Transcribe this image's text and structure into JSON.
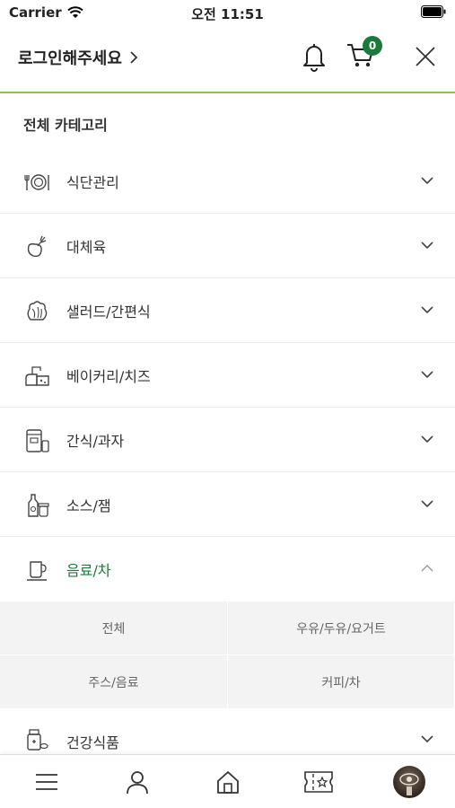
{
  "status_bar": {
    "carrier": "Carrier",
    "time": "오전 11:51"
  },
  "header": {
    "login_text": "로그인해주세요",
    "cart_count": "0"
  },
  "section_title": "전체 카테고리",
  "categories": [
    {
      "label": "식단관리",
      "icon": "meal-plan-icon"
    },
    {
      "label": "대체육",
      "icon": "meat-alternative-icon"
    },
    {
      "label": "샐러드/간편식",
      "icon": "salad-icon"
    },
    {
      "label": "베이커리/치즈",
      "icon": "bakery-icon"
    },
    {
      "label": "간식/과자",
      "icon": "snack-icon"
    },
    {
      "label": "소스/잼",
      "icon": "sauce-icon"
    },
    {
      "label": "음료/차",
      "icon": "drink-cup-icon",
      "expanded": true
    },
    {
      "label": "건강식품",
      "icon": "health-food-icon"
    }
  ],
  "subcategories": [
    "전체",
    "우유/두유/요거트",
    "주스/음료",
    "커피/차"
  ],
  "tabbar": [
    "menu-icon",
    "user-icon",
    "home-icon",
    "coupon-icon",
    "profile-avatar"
  ],
  "colors": {
    "accent": "#1a7a3a",
    "header_line": "#8bc34a",
    "subgrid_bg": "#f3f3f3"
  }
}
